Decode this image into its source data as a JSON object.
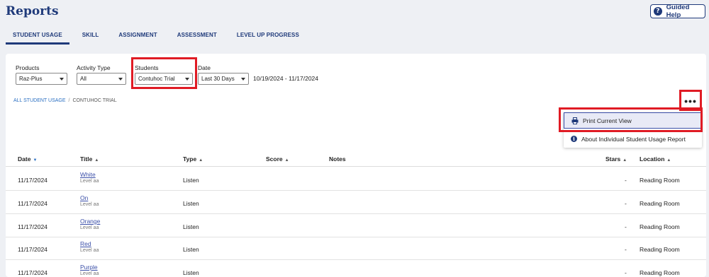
{
  "page": {
    "title": "Reports"
  },
  "help": {
    "label": "Guided Help",
    "icon": "?"
  },
  "tabs": [
    {
      "label": "STUDENT USAGE",
      "active": true
    },
    {
      "label": "SKILL"
    },
    {
      "label": "ASSIGNMENT"
    },
    {
      "label": "ASSESSMENT"
    },
    {
      "label": "LEVEL UP PROGRESS"
    }
  ],
  "filters": {
    "products": {
      "label": "Products",
      "value": "Raz-Plus"
    },
    "activity": {
      "label": "Activity Type",
      "value": "All"
    },
    "students": {
      "label": "Students",
      "value": "Contuhoc Trial"
    },
    "date": {
      "label": "Date",
      "value": "Last 30 Days",
      "range": "10/19/2024 - 11/17/2024"
    }
  },
  "breadcrumb": {
    "link": "ALL STUDENT USAGE",
    "sep": "/",
    "current": "CONTUHOC TRIAL"
  },
  "more": {
    "label": "•••"
  },
  "menu": {
    "print_label": "Print Current View",
    "about_label": "About Individual Student Usage Report"
  },
  "table": {
    "headers": {
      "date": "Date",
      "title": "Title",
      "type": "Type",
      "score": "Score",
      "notes": "Notes",
      "stars": "Stars",
      "location": "Location"
    },
    "rows": [
      {
        "date": "11/17/2024",
        "title": "White",
        "level": "Level aa",
        "type": "Listen",
        "stars": "-",
        "location": "Reading Room"
      },
      {
        "date": "11/17/2024",
        "title": "On",
        "level": "Level aa",
        "type": "Listen",
        "stars": "-",
        "location": "Reading Room"
      },
      {
        "date": "11/17/2024",
        "title": "Orange",
        "level": "Level aa",
        "type": "Listen",
        "stars": "-",
        "location": "Reading Room"
      },
      {
        "date": "11/17/2024",
        "title": "Red",
        "level": "Level aa",
        "type": "Listen",
        "stars": "-",
        "location": "Reading Room"
      },
      {
        "date": "11/17/2024",
        "title": "Purple",
        "level": "Level aa",
        "type": "Listen",
        "stars": "-",
        "location": "Reading Room"
      }
    ]
  },
  "colors": {
    "brand": "#1f3a7a",
    "highlight": "#e01b24",
    "link": "#2a6fc2"
  }
}
